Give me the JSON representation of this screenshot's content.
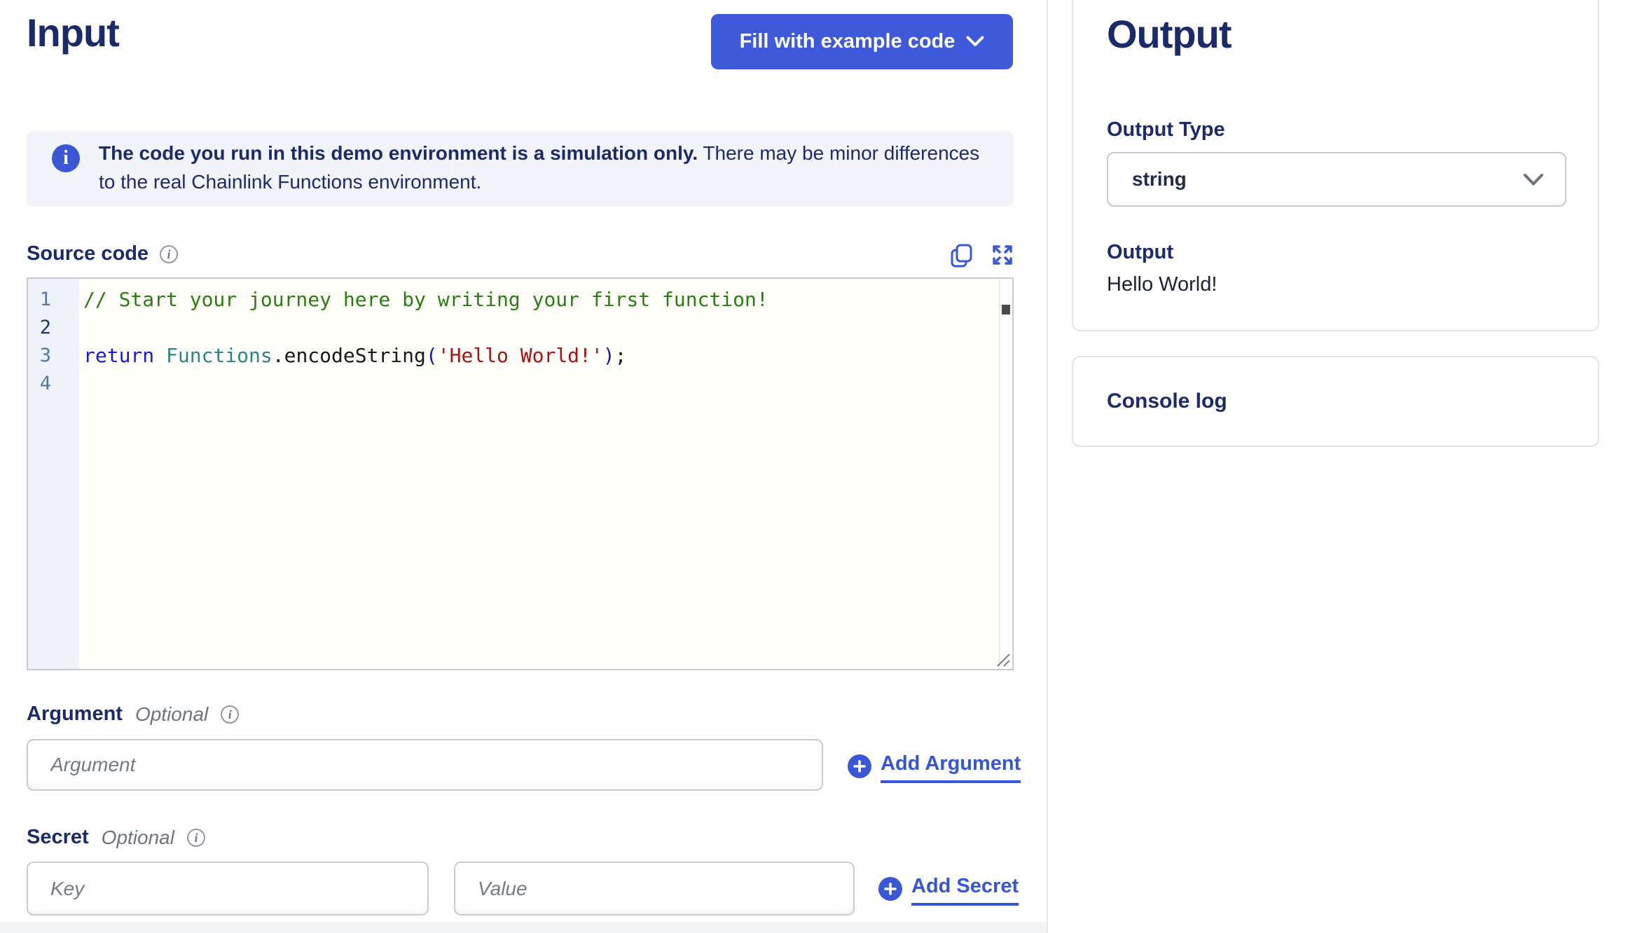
{
  "input": {
    "title": "Input",
    "fill_example_button": "Fill with example code",
    "banner": {
      "bold_text": "The code you run in this demo environment is a simulation only.",
      "regular_text": "There may be minor differences to the real Chainlink Functions environment."
    },
    "source_code": {
      "label": "Source code",
      "lines": [
        {
          "number": 1,
          "active": false,
          "tokens": [
            {
              "t": "comment",
              "v": "// Start your journey here by writing your first function!"
            }
          ]
        },
        {
          "number": 2,
          "active": true,
          "tokens": []
        },
        {
          "number": 3,
          "active": false,
          "tokens": [
            {
              "t": "keyword",
              "v": "return"
            },
            {
              "t": "plain",
              "v": " "
            },
            {
              "t": "variable",
              "v": "Functions"
            },
            {
              "t": "plain",
              "v": ".encodeString"
            },
            {
              "t": "bracket",
              "v": "("
            },
            {
              "t": "string",
              "v": "'Hello World!'"
            },
            {
              "t": "bracket",
              "v": ")"
            },
            {
              "t": "plain",
              "v": ";"
            }
          ]
        },
        {
          "number": 4,
          "active": false,
          "tokens": []
        }
      ]
    },
    "argument": {
      "label": "Argument",
      "optional": "Optional",
      "placeholder": "Argument",
      "add_button": "Add Argument"
    },
    "secret": {
      "label": "Secret",
      "optional": "Optional",
      "key_placeholder": "Key",
      "value_placeholder": "Value",
      "add_button": "Add Secret"
    }
  },
  "output": {
    "title": "Output",
    "type_label": "Output Type",
    "type_value": "string",
    "result_label": "Output",
    "result_value": "Hello World!",
    "console_label": "Console log"
  },
  "icons": {
    "banner_icon": "info-icon",
    "label_icons": "info-tooltip-icon",
    "editor_icons": [
      "copy-icon",
      "expand-icon"
    ],
    "button_icon": "chevron-down-icon",
    "add_icon": "plus-circle-icon"
  },
  "colors": {
    "brand_blue": "#3A57D6",
    "button_blue": "#3E59D9",
    "navy_text": "#1B2A6B",
    "banner_bg": "#F2F4FA",
    "code_comment": "#2A7D12",
    "code_keyword": "#1A1AD6",
    "code_variable": "#2E8484",
    "code_string": "#A31515",
    "gutter_bg": "#EEF1F8",
    "line_number": "#54799C",
    "active_line_number": "#24375F"
  }
}
